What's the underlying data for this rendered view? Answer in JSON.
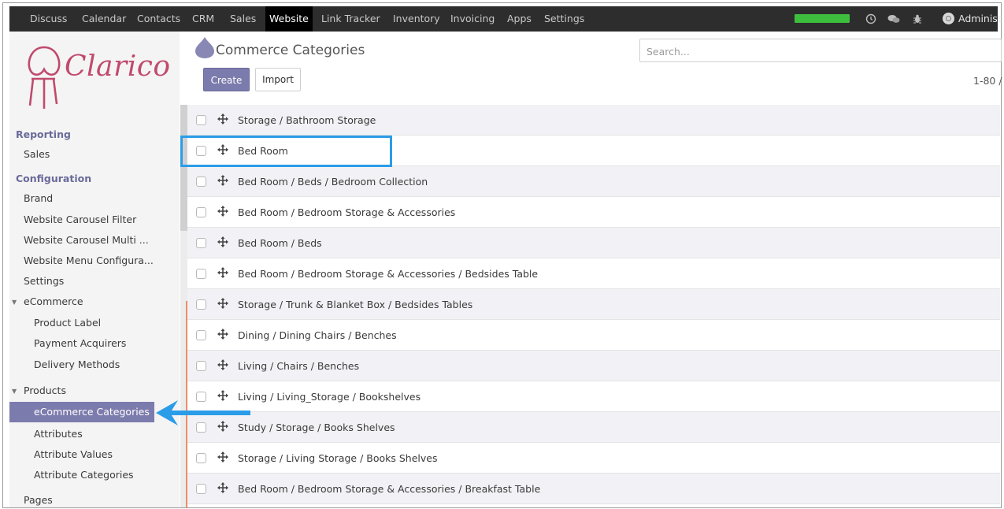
{
  "topbar": {
    "menu": [
      {
        "label": "Discuss"
      },
      {
        "label": "Calendar"
      },
      {
        "label": "Contacts"
      },
      {
        "label": "CRM"
      },
      {
        "label": "Sales"
      },
      {
        "label": "Website"
      },
      {
        "label": "Link Tracker"
      },
      {
        "label": "Inventory"
      },
      {
        "label": "Invoicing"
      },
      {
        "label": "Apps"
      },
      {
        "label": "Settings"
      }
    ],
    "active_menu": "Website",
    "progress": 1.0,
    "user_label": "Administ",
    "icons": [
      "clock-icon",
      "chat-icon",
      "bug-icon"
    ]
  },
  "logo": {
    "text": "Clarico"
  },
  "sidebar": {
    "reporting_header": "Reporting",
    "reporting_items": [
      {
        "label": "Sales"
      }
    ],
    "config_header": "Configuration",
    "config_items": [
      {
        "label": "Brand"
      },
      {
        "label": "Website Carousel Filter"
      },
      {
        "label": "Website Carousel Multi ..."
      },
      {
        "label": "Website Menu Configura..."
      },
      {
        "label": "Settings"
      }
    ],
    "ecommerce_group": "eCommerce",
    "ecommerce_items": [
      {
        "label": "Product Label"
      },
      {
        "label": "Payment Acquirers"
      },
      {
        "label": "Delivery Methods"
      }
    ],
    "products_group": "Products",
    "products_items": [
      {
        "label": "eCommerce Categories"
      },
      {
        "label": "Attributes"
      },
      {
        "label": "Attribute Values"
      },
      {
        "label": "Attribute Categories"
      }
    ],
    "pages_label": "Pages"
  },
  "main": {
    "title": "Commerce Categories",
    "search_placeholder": "Search...",
    "create_label": "Create",
    "import_label": "Import",
    "pager": "1-80 /"
  },
  "rows": [
    {
      "label": "Storage / Bathroom Storage"
    },
    {
      "label": "Bed Room"
    },
    {
      "label": "Bed Room / Beds / Bedroom Collection"
    },
    {
      "label": "Bed Room / Bedroom Storage & Accessories"
    },
    {
      "label": "Bed Room / Beds"
    },
    {
      "label": "Bed Room / Bedroom Storage & Accessories / Bedsides Table"
    },
    {
      "label": "Storage / Trunk & Blanket Box / Bedsides Tables"
    },
    {
      "label": "Dining / Dining Chairs / Benches"
    },
    {
      "label": "Living / Chairs / Benches"
    },
    {
      "label": "Living / Living_Storage / Bookshelves"
    },
    {
      "label": "Study / Storage / Books Shelves"
    },
    {
      "label": "Storage / Living Storage / Books Shelves"
    },
    {
      "label": "Bed Room / Bedroom Storage & Accessories / Breakfast Table"
    }
  ],
  "colors": {
    "brand": "#7c7bad",
    "logo": "#c04a6d",
    "annotation": "#2b9ce8",
    "topbar": "#2d2d2d"
  }
}
